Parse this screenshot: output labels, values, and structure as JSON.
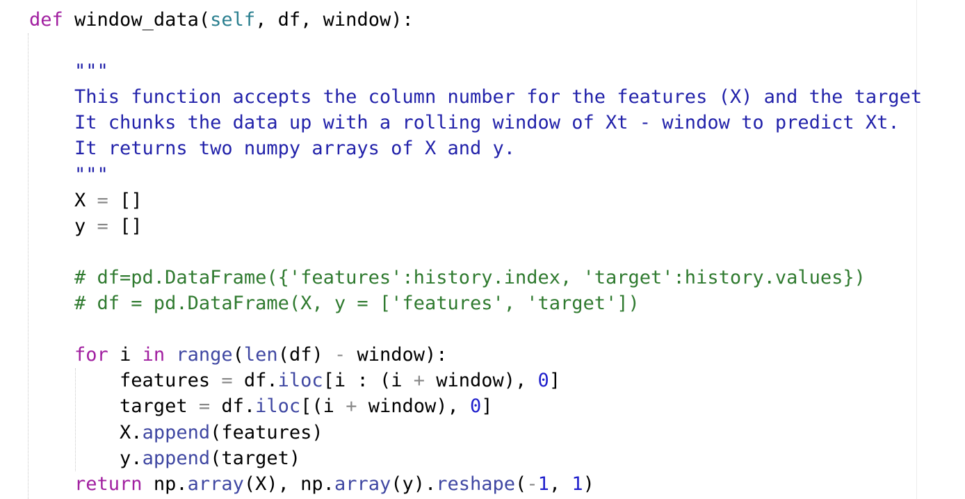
{
  "code": {
    "lines": [
      [
        {
          "t": "def",
          "c": "kw"
        },
        {
          "t": " window_data(",
          "c": "fn"
        },
        {
          "t": "self",
          "c": "self"
        },
        {
          "t": ", df, window):",
          "c": "fn"
        }
      ],
      [],
      [
        {
          "t": "    \"\"\"",
          "c": "str"
        }
      ],
      [
        {
          "t": "    This function accepts the column number for the features (X) and the target",
          "c": "str"
        }
      ],
      [
        {
          "t": "    It chunks the data up with a rolling window of Xt - window to predict Xt.",
          "c": "str"
        }
      ],
      [
        {
          "t": "    It returns two numpy arrays of X and y.",
          "c": "str"
        }
      ],
      [
        {
          "t": "    \"\"\"",
          "c": "str"
        }
      ],
      [
        {
          "t": "    X ",
          "c": "fn"
        },
        {
          "t": "=",
          "c": "op"
        },
        {
          "t": " []",
          "c": "fn"
        }
      ],
      [
        {
          "t": "    y ",
          "c": "fn"
        },
        {
          "t": "=",
          "c": "op"
        },
        {
          "t": " []",
          "c": "fn"
        }
      ],
      [],
      [
        {
          "t": "    # df=pd.DataFrame({'features':history.index, 'target':history.values})",
          "c": "com"
        }
      ],
      [
        {
          "t": "    # df = pd.DataFrame(X, y = ['features', 'target'])",
          "c": "com"
        }
      ],
      [],
      [
        {
          "t": "    ",
          "c": "fn"
        },
        {
          "t": "for",
          "c": "kw"
        },
        {
          "t": " i ",
          "c": "fn"
        },
        {
          "t": "in",
          "c": "kw"
        },
        {
          "t": " ",
          "c": "fn"
        },
        {
          "t": "range",
          "c": "bi"
        },
        {
          "t": "(",
          "c": "fn"
        },
        {
          "t": "len",
          "c": "bi"
        },
        {
          "t": "(df) ",
          "c": "fn"
        },
        {
          "t": "-",
          "c": "op"
        },
        {
          "t": " window):",
          "c": "fn"
        }
      ],
      [
        {
          "t": "        features ",
          "c": "fn"
        },
        {
          "t": "=",
          "c": "op"
        },
        {
          "t": " df.",
          "c": "fn"
        },
        {
          "t": "iloc",
          "c": "bi"
        },
        {
          "t": "[i : (i ",
          "c": "fn"
        },
        {
          "t": "+",
          "c": "op"
        },
        {
          "t": " window), ",
          "c": "fn"
        },
        {
          "t": "0",
          "c": "num"
        },
        {
          "t": "]",
          "c": "fn"
        }
      ],
      [
        {
          "t": "        target ",
          "c": "fn"
        },
        {
          "t": "=",
          "c": "op"
        },
        {
          "t": " df.",
          "c": "fn"
        },
        {
          "t": "iloc",
          "c": "bi"
        },
        {
          "t": "[(i ",
          "c": "fn"
        },
        {
          "t": "+",
          "c": "op"
        },
        {
          "t": " window), ",
          "c": "fn"
        },
        {
          "t": "0",
          "c": "num"
        },
        {
          "t": "]",
          "c": "fn"
        }
      ],
      [
        {
          "t": "        X.",
          "c": "fn"
        },
        {
          "t": "append",
          "c": "bi"
        },
        {
          "t": "(features)",
          "c": "fn"
        }
      ],
      [
        {
          "t": "        y.",
          "c": "fn"
        },
        {
          "t": "append",
          "c": "bi"
        },
        {
          "t": "(target)",
          "c": "fn"
        }
      ],
      [
        {
          "t": "    ",
          "c": "fn"
        },
        {
          "t": "return",
          "c": "kw"
        },
        {
          "t": " np.",
          "c": "fn"
        },
        {
          "t": "array",
          "c": "bi"
        },
        {
          "t": "(X), np.",
          "c": "fn"
        },
        {
          "t": "array",
          "c": "bi"
        },
        {
          "t": "(y).",
          "c": "fn"
        },
        {
          "t": "reshape",
          "c": "bi"
        },
        {
          "t": "(",
          "c": "fn"
        },
        {
          "t": "-",
          "c": "op"
        },
        {
          "t": "1",
          "c": "num"
        },
        {
          "t": ", ",
          "c": "fn"
        },
        {
          "t": "1",
          "c": "num"
        },
        {
          "t": ")",
          "c": "fn"
        }
      ]
    ]
  }
}
